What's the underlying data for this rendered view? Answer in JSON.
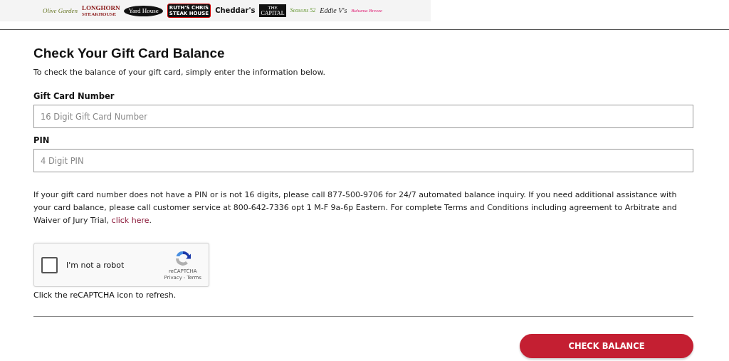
{
  "logos": [
    {
      "kind": "script",
      "text": "Olive Garden"
    },
    {
      "kind": "western",
      "text": "LONGHORN",
      "sub": "STEAKHOUSE"
    },
    {
      "kind": "oval",
      "text": "Yard House"
    },
    {
      "kind": "redbox",
      "text": "RUTH'S CHRIS",
      "sub": "STEAK HOUSE"
    },
    {
      "kind": "bold",
      "text": "Cheddar's"
    },
    {
      "kind": "blackbox",
      "text": "CAPITAL",
      "sub": "THE"
    },
    {
      "kind": "green",
      "text": "Seasons 52"
    },
    {
      "kind": "italic",
      "text": "Eddie V's"
    },
    {
      "kind": "pink",
      "text": "Bahama Breeze"
    }
  ],
  "title": "Check Your Gift Card Balance",
  "intro": "To check the balance of your gift card, simply enter the information below.",
  "fields": [
    {
      "label": "Gift Card Number",
      "placeholder": "16 Digit Gift Card Number"
    },
    {
      "label": "PIN",
      "placeholder": "4 Digit PIN"
    }
  ],
  "notice": {
    "text": "If your gift card number does not have a PIN or is not 16 digits, please call 877-500-9706 for 24/7 automated balance inquiry. If you need additional assistance with your card balance, please call customer service at 800-642-7336 opt 1 M-F 9a-6p Eastern. For complete Terms and Conditions including agreement to Arbitrate and Waiver of Jury Trial, ",
    "link": "click here",
    "end": "."
  },
  "captcha": {
    "checked": false,
    "label": "I'm not a robot",
    "brand": "reCAPTCHA",
    "privacy": "Privacy",
    "separator": "-",
    "terms": "Terms",
    "hint": "Click the reCAPTCHA icon to refresh."
  },
  "button": "CHECK BALANCE"
}
